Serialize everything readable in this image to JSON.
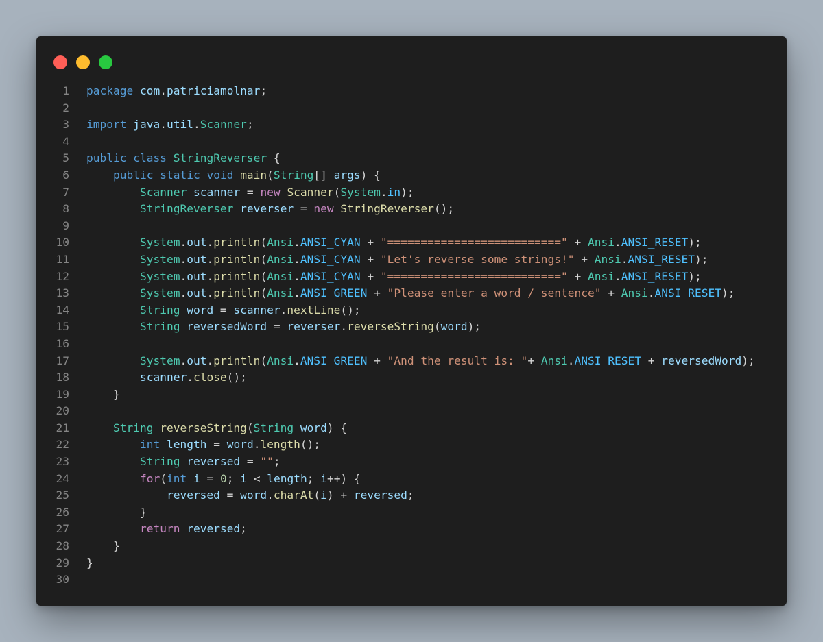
{
  "window": {
    "controls": [
      {
        "name": "close",
        "color": "#ff5f57"
      },
      {
        "name": "minimize",
        "color": "#febc2e"
      },
      {
        "name": "maximize",
        "color": "#28c840"
      }
    ]
  },
  "colors": {
    "background": "#a7b2bd",
    "editor_background": "#1e1e1e",
    "line_number": "#858585",
    "default_text": "#d4d4d4",
    "keyword": "#569cd6",
    "control_keyword": "#c586c0",
    "type": "#4ec9b0",
    "variable": "#9cdcfe",
    "function": "#dcdcaa",
    "string": "#ce9178",
    "number": "#b5cea8",
    "constant": "#4fc1ff"
  },
  "code": {
    "lines": [
      {
        "n": "1",
        "tokens": [
          [
            "package",
            "k"
          ],
          [
            " ",
            "p"
          ],
          [
            "com",
            "v"
          ],
          [
            ".",
            "p"
          ],
          [
            "patriciamolnar",
            "v"
          ],
          [
            ";",
            "p"
          ]
        ]
      },
      {
        "n": "2",
        "tokens": []
      },
      {
        "n": "3",
        "tokens": [
          [
            "import",
            "k"
          ],
          [
            " ",
            "p"
          ],
          [
            "java",
            "v"
          ],
          [
            ".",
            "p"
          ],
          [
            "util",
            "v"
          ],
          [
            ".",
            "p"
          ],
          [
            "Scanner",
            "t"
          ],
          [
            ";",
            "p"
          ]
        ]
      },
      {
        "n": "4",
        "tokens": []
      },
      {
        "n": "5",
        "tokens": [
          [
            "public",
            "k"
          ],
          [
            " ",
            "p"
          ],
          [
            "class",
            "k"
          ],
          [
            " ",
            "p"
          ],
          [
            "StringReverser",
            "t"
          ],
          [
            " {",
            "p"
          ]
        ]
      },
      {
        "n": "6",
        "tokens": [
          [
            "    ",
            "p"
          ],
          [
            "public",
            "k"
          ],
          [
            " ",
            "p"
          ],
          [
            "static",
            "k"
          ],
          [
            " ",
            "p"
          ],
          [
            "void",
            "k"
          ],
          [
            " ",
            "p"
          ],
          [
            "main",
            "f"
          ],
          [
            "(",
            "p"
          ],
          [
            "String",
            "t"
          ],
          [
            "[] ",
            "p"
          ],
          [
            "args",
            "v"
          ],
          [
            ") {",
            "p"
          ]
        ]
      },
      {
        "n": "7",
        "tokens": [
          [
            "        ",
            "p"
          ],
          [
            "Scanner",
            "t"
          ],
          [
            " ",
            "p"
          ],
          [
            "scanner",
            "v"
          ],
          [
            " = ",
            "p"
          ],
          [
            "new",
            "c"
          ],
          [
            " ",
            "p"
          ],
          [
            "Scanner",
            "f"
          ],
          [
            "(",
            "p"
          ],
          [
            "System",
            "t"
          ],
          [
            ".",
            "p"
          ],
          [
            "in",
            "o"
          ],
          [
            ");",
            "p"
          ]
        ]
      },
      {
        "n": "8",
        "tokens": [
          [
            "        ",
            "p"
          ],
          [
            "StringReverser",
            "t"
          ],
          [
            " ",
            "p"
          ],
          [
            "reverser",
            "v"
          ],
          [
            " = ",
            "p"
          ],
          [
            "new",
            "c"
          ],
          [
            " ",
            "p"
          ],
          [
            "StringReverser",
            "f"
          ],
          [
            "();",
            "p"
          ]
        ]
      },
      {
        "n": "9",
        "tokens": []
      },
      {
        "n": "10",
        "tokens": [
          [
            "        ",
            "p"
          ],
          [
            "System",
            "t"
          ],
          [
            ".",
            "p"
          ],
          [
            "out",
            "v"
          ],
          [
            ".",
            "p"
          ],
          [
            "println",
            "f"
          ],
          [
            "(",
            "p"
          ],
          [
            "Ansi",
            "t"
          ],
          [
            ".",
            "p"
          ],
          [
            "ANSI_CYAN",
            "o"
          ],
          [
            " + ",
            "p"
          ],
          [
            "\"==========================\"",
            "s"
          ],
          [
            " + ",
            "p"
          ],
          [
            "Ansi",
            "t"
          ],
          [
            ".",
            "p"
          ],
          [
            "ANSI_RESET",
            "o"
          ],
          [
            ");",
            "p"
          ]
        ]
      },
      {
        "n": "11",
        "tokens": [
          [
            "        ",
            "p"
          ],
          [
            "System",
            "t"
          ],
          [
            ".",
            "p"
          ],
          [
            "out",
            "v"
          ],
          [
            ".",
            "p"
          ],
          [
            "println",
            "f"
          ],
          [
            "(",
            "p"
          ],
          [
            "Ansi",
            "t"
          ],
          [
            ".",
            "p"
          ],
          [
            "ANSI_CYAN",
            "o"
          ],
          [
            " + ",
            "p"
          ],
          [
            "\"Let's reverse some strings!\"",
            "s"
          ],
          [
            " + ",
            "p"
          ],
          [
            "Ansi",
            "t"
          ],
          [
            ".",
            "p"
          ],
          [
            "ANSI_RESET",
            "o"
          ],
          [
            ");",
            "p"
          ]
        ]
      },
      {
        "n": "12",
        "tokens": [
          [
            "        ",
            "p"
          ],
          [
            "System",
            "t"
          ],
          [
            ".",
            "p"
          ],
          [
            "out",
            "v"
          ],
          [
            ".",
            "p"
          ],
          [
            "println",
            "f"
          ],
          [
            "(",
            "p"
          ],
          [
            "Ansi",
            "t"
          ],
          [
            ".",
            "p"
          ],
          [
            "ANSI_CYAN",
            "o"
          ],
          [
            " + ",
            "p"
          ],
          [
            "\"==========================\"",
            "s"
          ],
          [
            " + ",
            "p"
          ],
          [
            "Ansi",
            "t"
          ],
          [
            ".",
            "p"
          ],
          [
            "ANSI_RESET",
            "o"
          ],
          [
            ");",
            "p"
          ]
        ]
      },
      {
        "n": "13",
        "tokens": [
          [
            "        ",
            "p"
          ],
          [
            "System",
            "t"
          ],
          [
            ".",
            "p"
          ],
          [
            "out",
            "v"
          ],
          [
            ".",
            "p"
          ],
          [
            "println",
            "f"
          ],
          [
            "(",
            "p"
          ],
          [
            "Ansi",
            "t"
          ],
          [
            ".",
            "p"
          ],
          [
            "ANSI_GREEN",
            "o"
          ],
          [
            " + ",
            "p"
          ],
          [
            "\"Please enter a word / sentence\"",
            "s"
          ],
          [
            " + ",
            "p"
          ],
          [
            "Ansi",
            "t"
          ],
          [
            ".",
            "p"
          ],
          [
            "ANSI_RESET",
            "o"
          ],
          [
            ");",
            "p"
          ]
        ]
      },
      {
        "n": "14",
        "tokens": [
          [
            "        ",
            "p"
          ],
          [
            "String",
            "t"
          ],
          [
            " ",
            "p"
          ],
          [
            "word",
            "v"
          ],
          [
            " = ",
            "p"
          ],
          [
            "scanner",
            "v"
          ],
          [
            ".",
            "p"
          ],
          [
            "nextLine",
            "f"
          ],
          [
            "();",
            "p"
          ]
        ]
      },
      {
        "n": "15",
        "tokens": [
          [
            "        ",
            "p"
          ],
          [
            "String",
            "t"
          ],
          [
            " ",
            "p"
          ],
          [
            "reversedWord",
            "v"
          ],
          [
            " = ",
            "p"
          ],
          [
            "reverser",
            "v"
          ],
          [
            ".",
            "p"
          ],
          [
            "reverseString",
            "f"
          ],
          [
            "(",
            "p"
          ],
          [
            "word",
            "v"
          ],
          [
            ");",
            "p"
          ]
        ]
      },
      {
        "n": "16",
        "tokens": []
      },
      {
        "n": "17",
        "tokens": [
          [
            "        ",
            "p"
          ],
          [
            "System",
            "t"
          ],
          [
            ".",
            "p"
          ],
          [
            "out",
            "v"
          ],
          [
            ".",
            "p"
          ],
          [
            "println",
            "f"
          ],
          [
            "(",
            "p"
          ],
          [
            "Ansi",
            "t"
          ],
          [
            ".",
            "p"
          ],
          [
            "ANSI_GREEN",
            "o"
          ],
          [
            " + ",
            "p"
          ],
          [
            "\"And the result is: \"",
            "s"
          ],
          [
            "+ ",
            "p"
          ],
          [
            "Ansi",
            "t"
          ],
          [
            ".",
            "p"
          ],
          [
            "ANSI_RESET",
            "o"
          ],
          [
            " + ",
            "p"
          ],
          [
            "reversedWord",
            "v"
          ],
          [
            ");",
            "p"
          ]
        ]
      },
      {
        "n": "18",
        "tokens": [
          [
            "        ",
            "p"
          ],
          [
            "scanner",
            "v"
          ],
          [
            ".",
            "p"
          ],
          [
            "close",
            "f"
          ],
          [
            "();",
            "p"
          ]
        ]
      },
      {
        "n": "19",
        "tokens": [
          [
            "    }",
            "p"
          ]
        ]
      },
      {
        "n": "20",
        "tokens": []
      },
      {
        "n": "21",
        "tokens": [
          [
            "    ",
            "p"
          ],
          [
            "String",
            "t"
          ],
          [
            " ",
            "p"
          ],
          [
            "reverseString",
            "f"
          ],
          [
            "(",
            "p"
          ],
          [
            "String",
            "t"
          ],
          [
            " ",
            "p"
          ],
          [
            "word",
            "v"
          ],
          [
            ") {",
            "p"
          ]
        ]
      },
      {
        "n": "22",
        "tokens": [
          [
            "        ",
            "p"
          ],
          [
            "int",
            "k"
          ],
          [
            " ",
            "p"
          ],
          [
            "length",
            "v"
          ],
          [
            " = ",
            "p"
          ],
          [
            "word",
            "v"
          ],
          [
            ".",
            "p"
          ],
          [
            "length",
            "f"
          ],
          [
            "();",
            "p"
          ]
        ]
      },
      {
        "n": "23",
        "tokens": [
          [
            "        ",
            "p"
          ],
          [
            "String",
            "t"
          ],
          [
            " ",
            "p"
          ],
          [
            "reversed",
            "v"
          ],
          [
            " = ",
            "p"
          ],
          [
            "\"\"",
            "s"
          ],
          [
            ";",
            "p"
          ]
        ]
      },
      {
        "n": "24",
        "tokens": [
          [
            "        ",
            "p"
          ],
          [
            "for",
            "c"
          ],
          [
            "(",
            "p"
          ],
          [
            "int",
            "k"
          ],
          [
            " ",
            "p"
          ],
          [
            "i",
            "v"
          ],
          [
            " = ",
            "p"
          ],
          [
            "0",
            "n"
          ],
          [
            "; ",
            "p"
          ],
          [
            "i",
            "v"
          ],
          [
            " < ",
            "p"
          ],
          [
            "length",
            "v"
          ],
          [
            "; ",
            "p"
          ],
          [
            "i",
            "v"
          ],
          [
            "++) {",
            "p"
          ]
        ]
      },
      {
        "n": "25",
        "tokens": [
          [
            "            ",
            "p"
          ],
          [
            "reversed",
            "v"
          ],
          [
            " = ",
            "p"
          ],
          [
            "word",
            "v"
          ],
          [
            ".",
            "p"
          ],
          [
            "charAt",
            "f"
          ],
          [
            "(",
            "p"
          ],
          [
            "i",
            "v"
          ],
          [
            ") + ",
            "p"
          ],
          [
            "reversed",
            "v"
          ],
          [
            ";",
            "p"
          ]
        ]
      },
      {
        "n": "26",
        "tokens": [
          [
            "        }",
            "p"
          ]
        ]
      },
      {
        "n": "27",
        "tokens": [
          [
            "        ",
            "p"
          ],
          [
            "return",
            "c"
          ],
          [
            " ",
            "p"
          ],
          [
            "reversed",
            "v"
          ],
          [
            ";",
            "p"
          ]
        ]
      },
      {
        "n": "28",
        "tokens": [
          [
            "    }",
            "p"
          ]
        ]
      },
      {
        "n": "29",
        "tokens": [
          [
            "}",
            "p"
          ]
        ]
      },
      {
        "n": "30",
        "tokens": []
      }
    ]
  }
}
